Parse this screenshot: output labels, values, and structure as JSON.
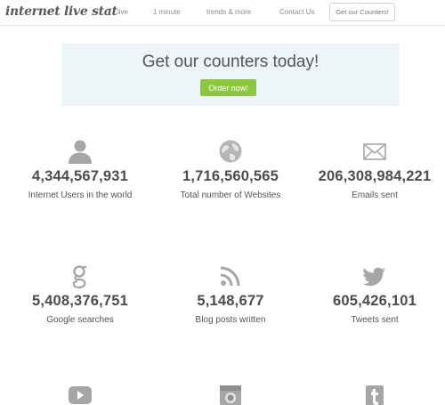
{
  "nav": {
    "logo": "internet live stat",
    "links": [
      "live",
      "1 minute",
      "trends & more",
      "Contact Us"
    ],
    "cta": "Get our Counters!"
  },
  "promo": {
    "title": "Get our counters today!",
    "button": "Order now!"
  },
  "stats": [
    {
      "icon": "user-icon",
      "value": "4,344,567,931",
      "label": "Internet Users in the world"
    },
    {
      "icon": "globe-icon",
      "value": "1,716,560,565",
      "label": "Total number of Websites"
    },
    {
      "icon": "envelope-icon",
      "value": "206,308,984,221",
      "label": "Emails sent"
    },
    {
      "icon": "google-icon",
      "value": "5,408,376,751",
      "label": "Google searches"
    },
    {
      "icon": "rss-icon",
      "value": "5,148,677",
      "label": "Blog posts written"
    },
    {
      "icon": "twitter-icon",
      "value": "605,426,101",
      "label": "Tweets sent"
    },
    {
      "icon": "youtube-icon"
    },
    {
      "icon": "instagram-icon"
    },
    {
      "icon": "tumblr-icon"
    }
  ],
  "colors": {
    "accent_green": "#8dc63f",
    "promo_bg": "#eef5f9",
    "icon_gray": "#a6a6a6"
  }
}
